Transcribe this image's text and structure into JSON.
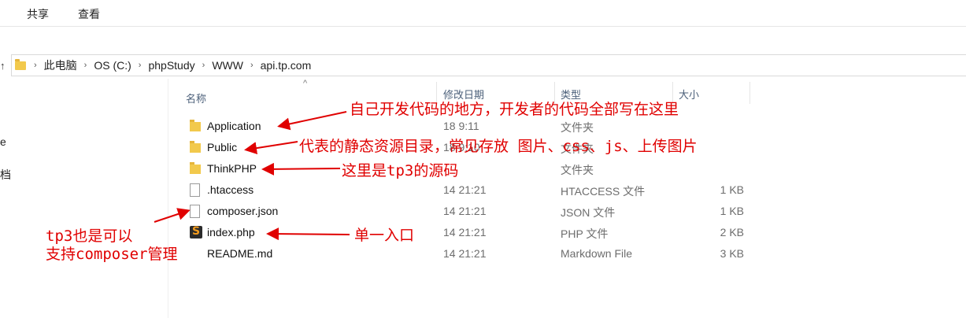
{
  "ribbon": {
    "tabs": [
      {
        "label": "共享"
      },
      {
        "label": "查看"
      }
    ]
  },
  "address": {
    "crumbs": [
      "此电脑",
      "OS (C:)",
      "phpStudy",
      "WWW",
      "api.tp.com"
    ]
  },
  "nav_fragments": [
    "e",
    "档"
  ],
  "columns": {
    "name": "名称",
    "modified": "修改日期",
    "type": "类型",
    "size": "大小"
  },
  "files": [
    {
      "name": "Application",
      "date": "18 9:11",
      "type": "文件夹",
      "size": "",
      "icon": "folder-icon"
    },
    {
      "name": "Public",
      "date": "18 9:10",
      "type": "文件夹",
      "size": "",
      "icon": "folder-icon"
    },
    {
      "name": "ThinkPHP",
      "date": "",
      "type": "文件夹",
      "size": "",
      "icon": "folder-icon"
    },
    {
      "name": ".htaccess",
      "date": "14 21:21",
      "type": "HTACCESS 文件",
      "size": "1 KB",
      "icon": "file-icon"
    },
    {
      "name": "composer.json",
      "date": "14 21:21",
      "type": "JSON 文件",
      "size": "1 KB",
      "icon": "file-icon"
    },
    {
      "name": "index.php",
      "date": "14 21:21",
      "type": "PHP 文件",
      "size": "2 KB",
      "icon": "sublime-php-icon"
    },
    {
      "name": "README.md",
      "date": "14 21:21",
      "type": "Markdown File",
      "size": "3 KB",
      "icon": "markdown-file-icon"
    }
  ],
  "annotations": {
    "application": "自己开发代码的地方，开发者的代码全部写在这里",
    "public": "代表的静态资源目录，常见存放 图片、css、js、上传图片",
    "thinkphp": "这里是tp3的源码",
    "index": "单一入口",
    "composer_line1": "tp3也是可以",
    "composer_line2": "支持composer管理"
  },
  "colors": {
    "annotation": "#e00000",
    "folder": "#f2c94c",
    "header_text": "#4c607a"
  }
}
